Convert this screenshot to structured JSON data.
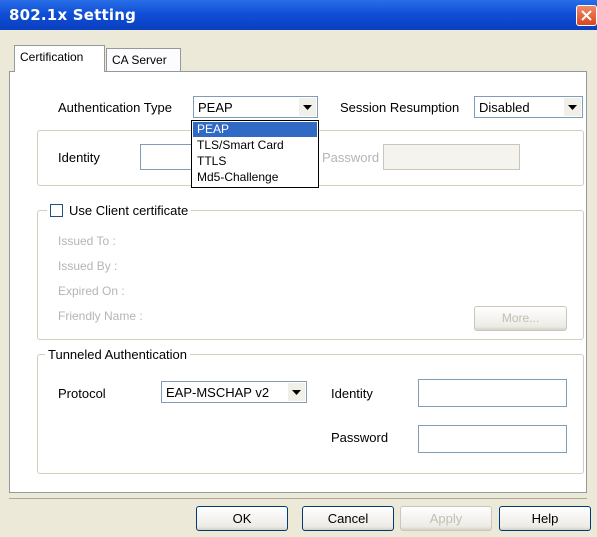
{
  "window": {
    "title": "802.1x Setting"
  },
  "tabs": [
    {
      "label": "Certification",
      "active": true
    },
    {
      "label": "CA Server",
      "active": false
    }
  ],
  "auth": {
    "type_label": "Authentication Type",
    "type_value": "PEAP",
    "session_label": "Session Resumption",
    "session_value": "Disabled",
    "dropdown_options": [
      "PEAP",
      "TLS/Smart Card",
      "TTLS",
      "Md5-Challenge"
    ],
    "dropdown_selected": "PEAP"
  },
  "identity": {
    "label": "Identity",
    "value": "",
    "password_label": "Password",
    "password_value": ""
  },
  "client_cert": {
    "checkbox_label": "Use Client certificate",
    "checked": false,
    "issued_to": "Issued To :",
    "issued_by": "Issued By :",
    "expired_on": "Expired On :",
    "friendly_name": "Friendly Name :",
    "more_button": "More..."
  },
  "tunneled": {
    "legend": "Tunneled Authentication",
    "protocol_label": "Protocol",
    "protocol_value": "EAP-MSCHAP v2",
    "identity_label": "Identity",
    "identity_value": "",
    "password_label": "Password",
    "password_value": ""
  },
  "buttons": {
    "ok": "OK",
    "cancel": "Cancel",
    "apply": "Apply",
    "help": "Help"
  },
  "colors": {
    "titlebar": "#0f4fd6",
    "selection": "#316ac5",
    "dialog_bg": "#ece9d8"
  }
}
